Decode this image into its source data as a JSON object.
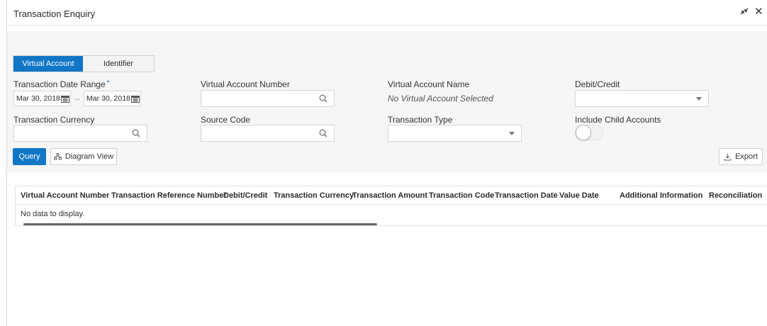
{
  "window": {
    "title": "Transaction Enquiry",
    "minimize_icon": "↗↙",
    "close_icon": "✕"
  },
  "tabs": [
    {
      "label": "Virtual Account",
      "active": true
    },
    {
      "label": "Identifier",
      "active": false
    }
  ],
  "form": {
    "date_range_label": "Transaction Date Range",
    "required_mark": "*",
    "date_from": "Mar 30, 2018",
    "date_to": "Mar 30, 2018",
    "date_separator": "↔",
    "va_number_label": "Virtual Account Number",
    "va_number_value": "",
    "va_name_label": "Virtual Account Name",
    "va_name_value": "No Virtual Account Selected",
    "debit_credit_label": "Debit/Credit",
    "debit_credit_value": "",
    "currency_label": "Transaction Currency",
    "currency_value": "",
    "source_code_label": "Source Code",
    "source_code_value": "",
    "txn_type_label": "Transaction Type",
    "txn_type_value": "",
    "include_child_label": "Include Child Accounts",
    "include_child_on": false
  },
  "actions": {
    "query_label": "Query",
    "diagram_label": "Diagram View",
    "export_label": "Export"
  },
  "table": {
    "columns": [
      "Virtual Account Number",
      "Transaction Reference Number",
      "Debit/Credit",
      "Transaction Currency",
      "Transaction Amount",
      "Transaction Code",
      "Transaction Date",
      "Value Date",
      "Additional Information",
      "Reconciliation"
    ],
    "rows": [],
    "empty_text": "No data to display."
  },
  "colors": {
    "accent": "#1276c6",
    "panel_bg": "#f6f6f6"
  }
}
